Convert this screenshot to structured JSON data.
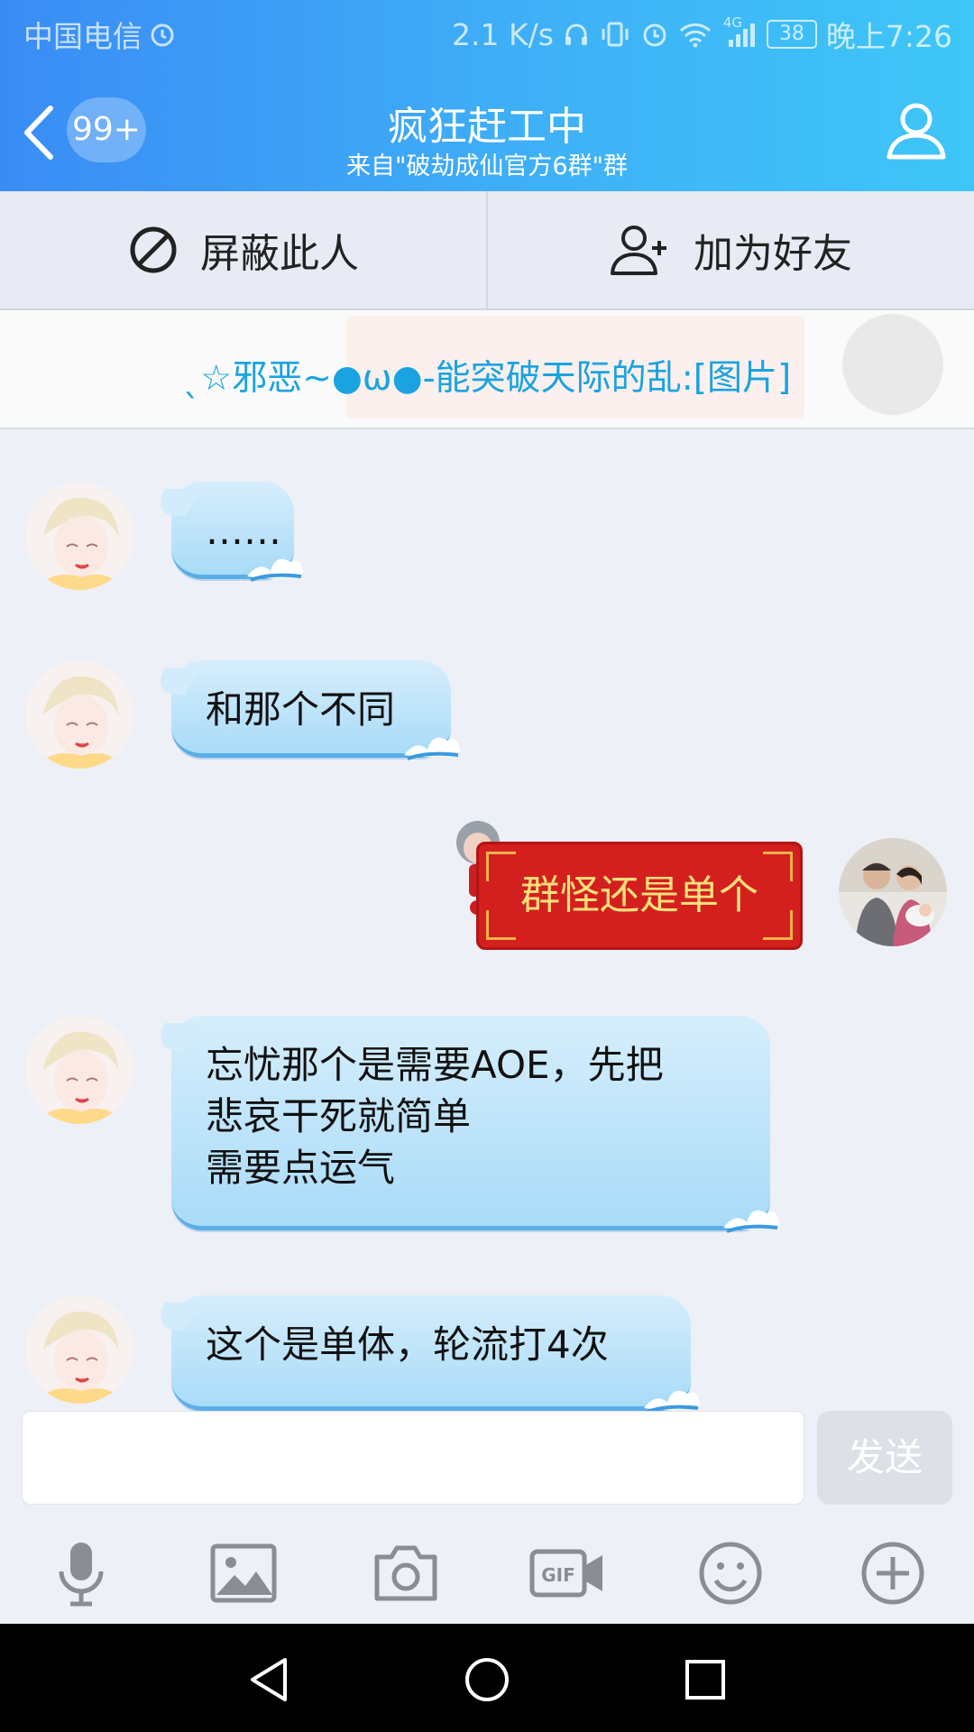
{
  "statusbar": {
    "carrier": "中国电信",
    "speed": "2.1 K/s",
    "battery": "38",
    "time": "晚上7:26",
    "network": "4G"
  },
  "header": {
    "badge": "99+",
    "title": "疯狂赶工中",
    "subtitle": "来自\"破劫成仙官方6群\"群"
  },
  "actions": {
    "block": "屏蔽此人",
    "add_friend": "加为好友"
  },
  "notice": {
    "text": "ˎ☆邪恶~●ω●-能突破天际的乱:[图片]"
  },
  "messages": [
    {
      "side": "left",
      "text": "……"
    },
    {
      "side": "left",
      "text": "和那个不同"
    },
    {
      "side": "right",
      "text": "群怪还是单个"
    },
    {
      "side": "left",
      "line1": "忘忧那个是需要AOE，先把",
      "line2": "悲哀干死就简单",
      "line3": "需要点运气"
    },
    {
      "side": "left",
      "text": "这个是单体，轮流打4次"
    }
  ],
  "input": {
    "send_label": "发送"
  },
  "colors": {
    "header_start": "#3a8cf5",
    "header_end": "#3ec6f7",
    "bubble": "#a9dbf8",
    "red_bubble": "#d41f1f",
    "notice_text": "#1aa3e0"
  },
  "icons": {
    "back": "chevron-left-icon",
    "profile": "person-icon",
    "block": "prohibit-icon",
    "add_friend": "person-add-icon",
    "toolbar": [
      "microphone-icon",
      "image-icon",
      "camera-icon",
      "gif-icon",
      "emoji-icon",
      "plus-icon"
    ],
    "nav": [
      "back-triangle-icon",
      "home-circle-icon",
      "recents-square-icon"
    ]
  }
}
